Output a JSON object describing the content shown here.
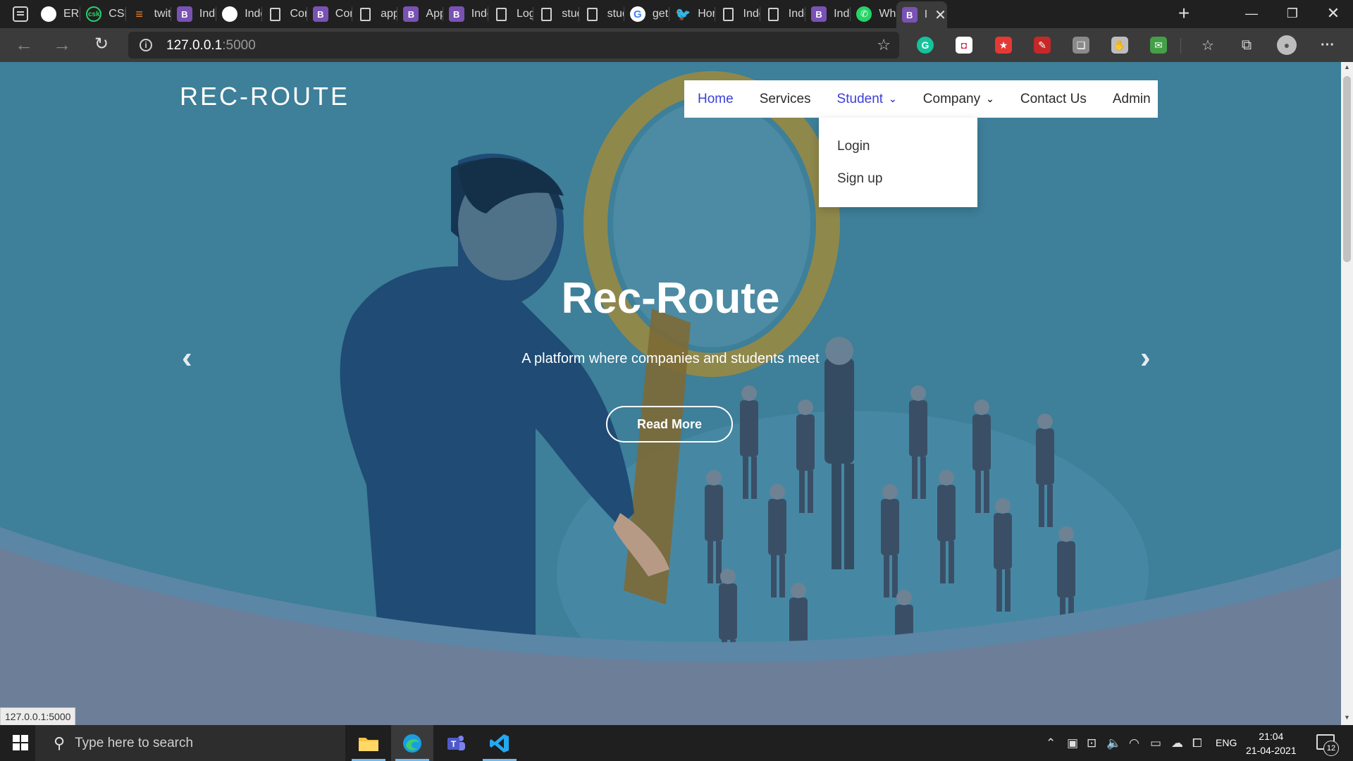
{
  "browser": {
    "tabs": [
      {
        "label": "ERRC",
        "icon": "github-icon",
        "glyph": ""
      },
      {
        "label": "CSK",
        "icon": "csk-icon",
        "glyph": "csk"
      },
      {
        "label": "twitte",
        "icon": "stackoverflow-icon",
        "glyph": "≡"
      },
      {
        "label": "Index",
        "icon": "bootstrap-icon",
        "glyph": "B"
      },
      {
        "label": "Index",
        "icon": "github-icon",
        "glyph": ""
      },
      {
        "label": "Com",
        "icon": "page-icon",
        "glyph": ""
      },
      {
        "label": "Com",
        "icon": "bootstrap-icon",
        "glyph": "B"
      },
      {
        "label": "apply",
        "icon": "page-icon",
        "glyph": ""
      },
      {
        "label": "Appl",
        "icon": "bootstrap-icon",
        "glyph": "B"
      },
      {
        "label": "Index",
        "icon": "bootstrap-icon",
        "glyph": "B"
      },
      {
        "label": "Login",
        "icon": "page-icon",
        "glyph": ""
      },
      {
        "label": "stude",
        "icon": "page-icon",
        "glyph": ""
      },
      {
        "label": "stude",
        "icon": "page-icon",
        "glyph": ""
      },
      {
        "label": "get /",
        "icon": "google-icon",
        "glyph": "G"
      },
      {
        "label": "Hom",
        "icon": "twitter-icon",
        "glyph": "🐦"
      },
      {
        "label": "Index",
        "icon": "page-icon",
        "glyph": ""
      },
      {
        "label": "Index",
        "icon": "page-icon",
        "glyph": ""
      },
      {
        "label": "Inde",
        "icon": "bootstrap-icon",
        "glyph": "B"
      },
      {
        "label": "Wha",
        "icon": "whatsapp-icon",
        "glyph": "✆"
      },
      {
        "label": "I",
        "icon": "bootstrap-icon",
        "glyph": "B",
        "active": true
      }
    ],
    "url_host": "127.0.0.1",
    "url_port": ":5000",
    "status_url": "127.0.0.1:5000"
  },
  "site": {
    "brand": "REC-ROUTE",
    "nav": {
      "home": "Home",
      "services": "Services",
      "student": "Student",
      "company": "Company",
      "contact": "Contact Us",
      "admin": "Admin"
    },
    "student_dropdown": {
      "login": "Login",
      "signup": "Sign up"
    },
    "hero": {
      "title": "Rec-Route",
      "subtitle": "A platform where companies and students meet",
      "button": "Read More"
    }
  },
  "taskbar": {
    "search_placeholder": "Type here to search",
    "lang": "ENG",
    "time": "21:04",
    "date": "21-04-2021",
    "notifications": "12"
  },
  "colors": {
    "hero_bg": "#3f7f9a",
    "nav_active": "#3b40d8",
    "page_bottom": "#6d7e98"
  }
}
